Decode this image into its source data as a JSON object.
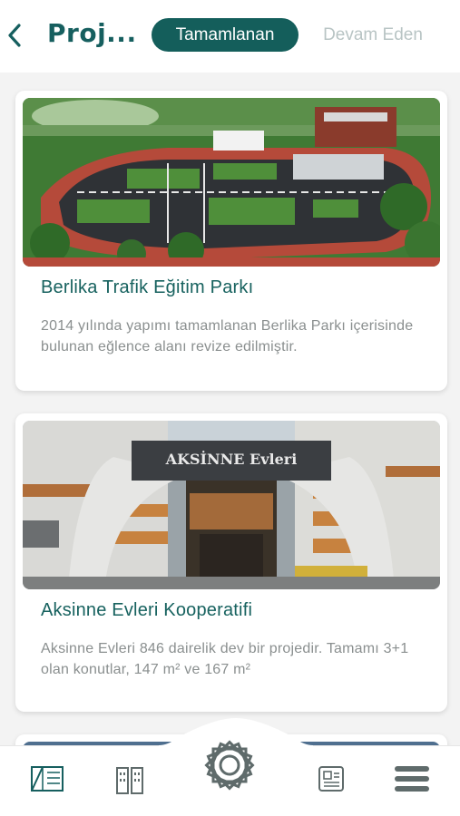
{
  "header": {
    "title": "Proj...",
    "back_icon": "chevron-left-icon",
    "tabs": [
      {
        "label": "Tamamlanan",
        "active": true
      },
      {
        "label": "Devam Eden",
        "active": false
      }
    ]
  },
  "projects": [
    {
      "title": "Berlika Trafik Eğitim Parkı",
      "description": "2014 yılında yapımı tamamlanan Berlika Parkı içerisinde bulunan eğlence alanı revize edilmiştir.",
      "image": "traffic-park-aerial-photo"
    },
    {
      "title": "Aksinne Evleri Kooperatifi",
      "description": "Aksinne Evleri 846 dairelik dev bir projedir. Tamamı 3+1 olan konutlar, 147 m² ve 167 m²",
      "image": "apartment-complex-entrance-photo",
      "image_sign": "AKSİNNE Evleri"
    }
  ],
  "bottom_nav": {
    "items": [
      "blueprint-icon",
      "buildings-icon",
      "logo-icon",
      "news-icon",
      "menu-icon"
    ]
  },
  "colors": {
    "primary": "#145e5b",
    "title": "#165f5f",
    "inactive_tab": "#b8c4c4",
    "description": "#8a8f8f",
    "background": "#f3f3f3"
  }
}
